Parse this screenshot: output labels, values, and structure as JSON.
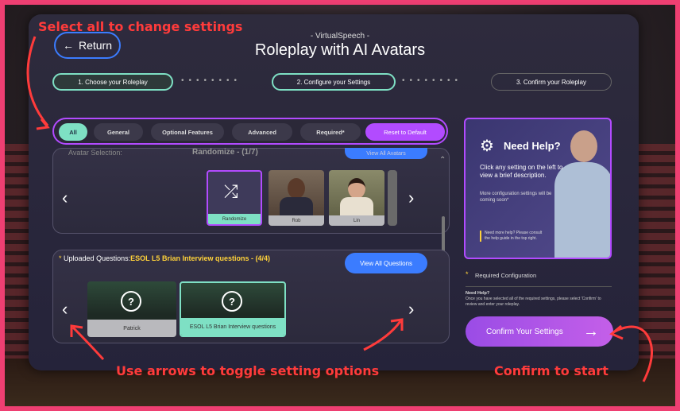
{
  "annotations": {
    "top": "Select all to change settings",
    "bottom_left": "Use arrows to toggle setting options",
    "bottom_right": "Confirm to start"
  },
  "header": {
    "return_label": "Return",
    "subtitle": "- VirtualSpeech -",
    "title": "Roleplay with AI Avatars"
  },
  "steps": [
    {
      "label": "1. Choose your Roleplay"
    },
    {
      "label": "2. Configure your Settings"
    },
    {
      "label": "3. Confirm your Roleplay"
    }
  ],
  "filters": {
    "all": "All",
    "general": "General",
    "optional": "Optional Features",
    "advanced": "Advanced",
    "required": "Required*",
    "reset": "Reset to Default"
  },
  "avatar_section": {
    "label": "Avatar Selection:",
    "value": "Randomize - (1/7)",
    "view_all": "View All Avatars",
    "tiles": [
      {
        "label": "Randomize"
      },
      {
        "label": "Rob"
      },
      {
        "label": "Lin"
      }
    ]
  },
  "questions_section": {
    "asterisk": "*",
    "label": "Uploaded Questions:",
    "value": "ESOL L5 Brian Interview questions - (4/4)",
    "view_all": "View All Questions",
    "tiles": [
      {
        "label": "Patrick"
      },
      {
        "label": "ESOL L5 Brian Interview questions"
      }
    ]
  },
  "help": {
    "title": "Need Help?",
    "desc": "Click any setting on the left to view a brief description.",
    "more": "More configuration settings will be coming soon*",
    "consult": "Need more help? Please consult the help guide in the top right."
  },
  "required_note": "Required Configuration",
  "need_help_small": "Need Help?",
  "confirm_note": "Once you have selected all of the required settings, please select 'Confirm' to review and enter your roleplay.",
  "confirm_label": "Confirm Your Settings",
  "colors": {
    "accent_purple": "#b24bff",
    "accent_teal": "#7ee0c4",
    "accent_blue": "#3b7cff",
    "annotation_red": "#ff3b3b",
    "border_pink": "#ee3f72"
  }
}
